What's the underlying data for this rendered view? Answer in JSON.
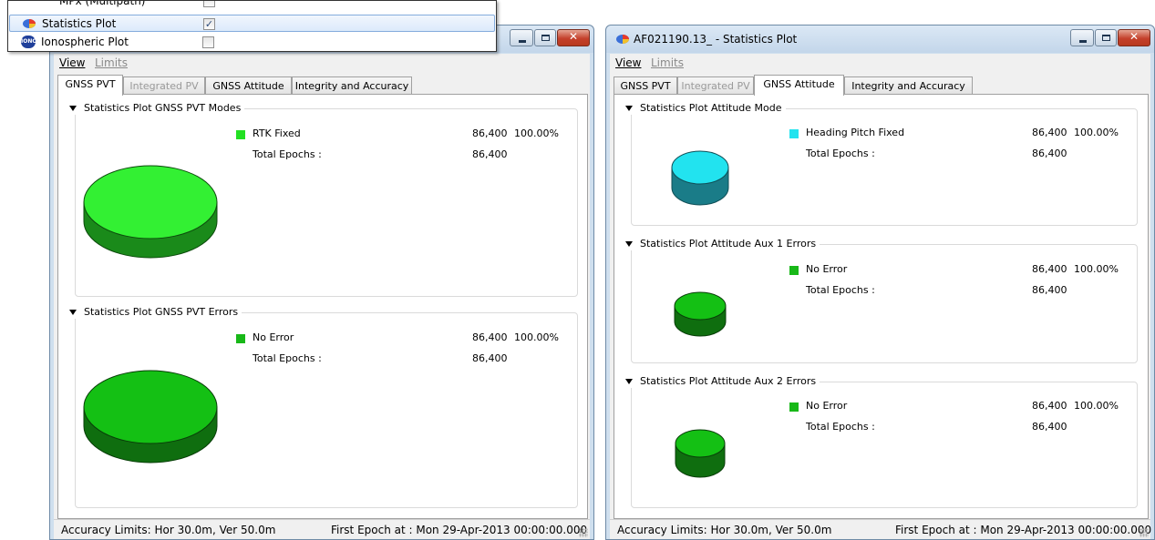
{
  "popup": {
    "items": [
      {
        "label": "MPx (Multipath)",
        "checked": false
      },
      {
        "label": "Statistics Plot",
        "checked": true,
        "icon": "pie-icon"
      },
      {
        "label": "Ionospheric Plot",
        "checked": false,
        "icon": "iono-icon",
        "icon_text": "IONO"
      }
    ],
    "check_mark": "✓"
  },
  "left_window": {
    "title": "",
    "menu": {
      "view": "View",
      "limits": "Limits"
    },
    "tabs": [
      "GNSS PVT",
      "Integrated PV",
      "GNSS Attitude",
      "Integrity and Accuracy"
    ],
    "active_tab": 0,
    "groups": [
      {
        "title": "Statistics Plot GNSS PVT Modes",
        "legend": [
          {
            "label": "RTK Fixed",
            "value": "86,400",
            "percent": "100.00%",
            "color": "#22e022"
          }
        ],
        "total_label": "Total Epochs :",
        "total_value": "86,400",
        "pie_top": "#33f033",
        "pie_side": "#1a8a1a"
      },
      {
        "title": "Statistics Plot GNSS PVT Errors",
        "legend": [
          {
            "label": "No Error",
            "value": "86,400",
            "percent": "100.00%",
            "color": "#18b818"
          }
        ],
        "total_label": "Total Epochs :",
        "total_value": "86,400",
        "pie_top": "#14c014",
        "pie_side": "#0f6e0f"
      }
    ],
    "status": {
      "left": "Accuracy Limits: Hor 30.0m, Ver 50.0m",
      "right": "First Epoch at : Mon 29-Apr-2013 00:00:00.000"
    }
  },
  "right_window": {
    "title": "AF021190.13_ - Statistics Plot",
    "menu": {
      "view": "View",
      "limits": "Limits"
    },
    "tabs": [
      "GNSS PVT",
      "Integrated PV",
      "GNSS Attitude",
      "Integrity and Accuracy"
    ],
    "active_tab": 2,
    "groups": [
      {
        "title": "Statistics Plot Attitude Mode",
        "legend": [
          {
            "label": "Heading Pitch Fixed",
            "value": "86,400",
            "percent": "100.00%",
            "color": "#22e3ef"
          }
        ],
        "total_label": "Total Epochs :",
        "total_value": "86,400",
        "pie_top": "#22e3ef",
        "pie_side": "#1a7c88"
      },
      {
        "title": "Statistics Plot Attitude Aux 1 Errors",
        "legend": [
          {
            "label": "No Error",
            "value": "86,400",
            "percent": "100.00%",
            "color": "#18b818"
          }
        ],
        "total_label": "Total Epochs :",
        "total_value": "86,400",
        "pie_top": "#14c014",
        "pie_side": "#0f6e0f"
      },
      {
        "title": "Statistics Plot Attitude Aux 2 Errors",
        "legend": [
          {
            "label": "No Error",
            "value": "86,400",
            "percent": "100.00%",
            "color": "#18b818"
          }
        ],
        "total_label": "Total Epochs :",
        "total_value": "86,400",
        "pie_top": "#14c014",
        "pie_side": "#0f6e0f"
      }
    ],
    "status": {
      "left": "Accuracy Limits: Hor 30.0m, Ver 50.0m",
      "right": "First Epoch at : Mon 29-Apr-2013 00:00:00.000"
    }
  },
  "window_controls": {
    "minimize": "minimize",
    "maximize": "maximize",
    "close": "✕"
  }
}
